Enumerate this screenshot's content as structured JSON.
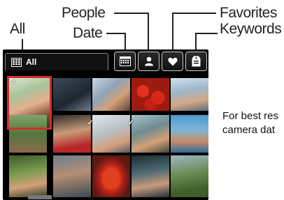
{
  "callouts": {
    "all": "All",
    "people": "People",
    "date": "Date",
    "favorites": "Favorites",
    "keywords": "Keywords"
  },
  "tabs": {
    "all_label": "All",
    "icons": [
      "calendar-icon",
      "person-icon",
      "heart-icon",
      "tag-icon"
    ]
  },
  "side_text": {
    "line1": "For best res",
    "line2": "camera dat"
  },
  "colors": {
    "selection": "#d62b2b",
    "background": "#000000"
  }
}
